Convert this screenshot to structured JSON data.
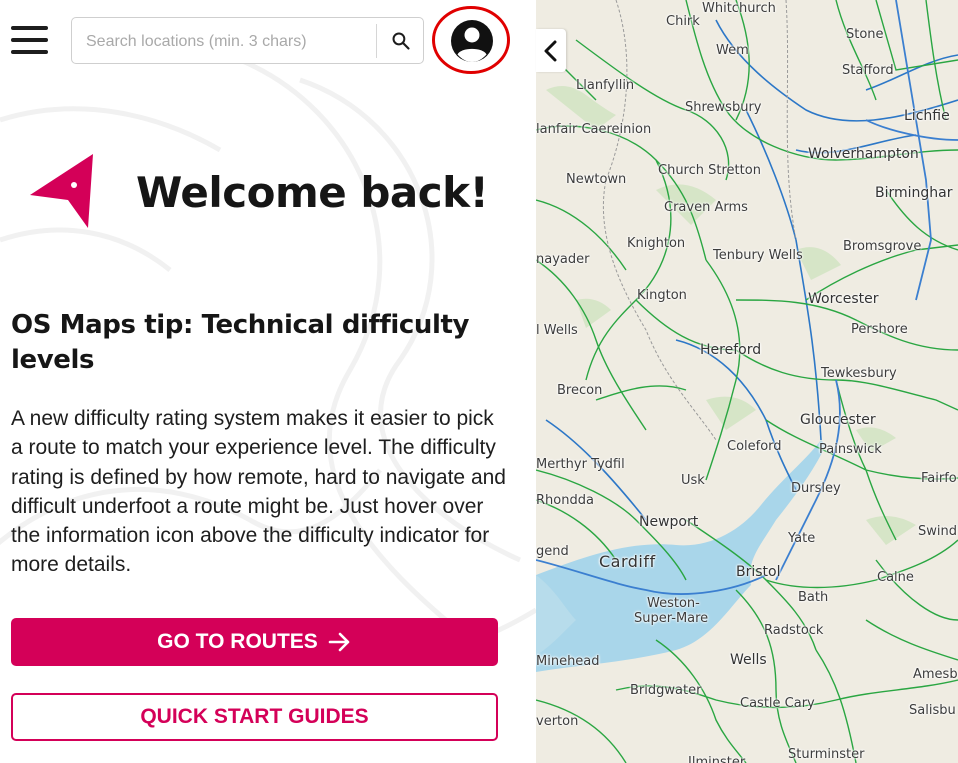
{
  "header": {
    "search_placeholder": "Search locations (min. 3 chars)",
    "search_value": "",
    "icons": {
      "menu": "hamburger-icon",
      "search": "search-icon",
      "account": "account-icon"
    },
    "account_highlight_color": "#e00000"
  },
  "welcome": {
    "title": "Welcome back!",
    "icon": "navigation-arrow-icon"
  },
  "tip": {
    "title": "OS Maps tip: Technical difficulty levels",
    "body": "A new difficulty rating system makes it easier to pick a route to match your experience level. The difficulty rating is defined by how remote, hard to navigate and difficult underfoot a route might be. Just hover over the information icon above the difficulty indicator for more details."
  },
  "buttons": {
    "routes_label": "GO TO ROUTES",
    "guides_label": "QUICK START GUIDES"
  },
  "colors": {
    "accent": "#d40058",
    "map_background": "#efece2",
    "road_green": "#2aa642",
    "river_blue": "#2c77c7",
    "sea": "#a9d6ea"
  },
  "map": {
    "collapse_icon": "chevron-left-icon",
    "places": [
      "Whitchurch",
      "Chirk",
      "Stone",
      "Wem",
      "Stafford",
      "Llanfyllin",
      "Shrewsbury",
      "Lichfie",
      "lanfair Caereinion",
      "Wolverhampton",
      "Newtown",
      "Church Stretton",
      "Birminghar",
      "Craven Arms",
      "Knighton",
      "Bromsgrove",
      "nayader",
      "Tenbury Wells",
      "Kington",
      "Worcester",
      "l Wells",
      "Pershore",
      "Hereford",
      "Brecon",
      "Tewkesbury",
      "Gloucester",
      "Coleford",
      "Painswick",
      "Merthyr Tydfil",
      "Usk",
      "Fairfo",
      "Dursley",
      "Rhondda",
      "Newport",
      "Swind",
      "Yate",
      "gend",
      "Cardiff",
      "Bristol",
      "Calne",
      "Bath",
      "Weston-",
      "Super-Mare",
      "Radstock",
      "Minehead",
      "Wells",
      "Amesb",
      "Bridgwater",
      "Castle Cary",
      "Salisbu",
      "verton",
      "Sturminster",
      "Ilminster"
    ]
  }
}
